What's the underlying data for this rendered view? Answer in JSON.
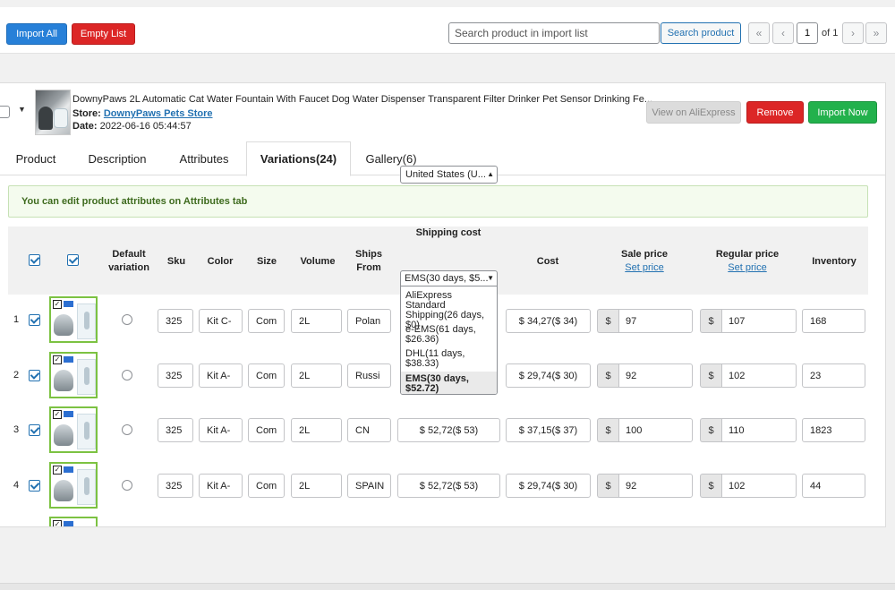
{
  "toolbar": {
    "import_all": "Import All",
    "empty_list": "Empty List",
    "search_placeholder": "Search product in import list",
    "search_button": "Search product",
    "first": "«",
    "prev": "‹",
    "page": "1",
    "of": "of 1",
    "next": "›",
    "last": "»"
  },
  "product": {
    "title": "DownyPaws 2L Automatic Cat Water Fountain With Faucet Dog Water Dispenser Transparent Filter Drinker Pet Sensor Drinking Fe...",
    "store_label": "Store:",
    "store_name": "DownyPaws Pets Store",
    "date_label": "Date:",
    "date": "2022-06-16 05:44:57",
    "view_btn": "View on AliExpress",
    "remove_btn": "Remove",
    "import_btn": "Import Now"
  },
  "tabs": [
    "Product",
    "Description",
    "Attributes",
    "Variations(24)",
    "Gallery(6)"
  ],
  "active_tab": "Variations(24)",
  "notice": "You can edit product attributes on Attributes tab",
  "table": {
    "headers": {
      "default_variation": "Default variation",
      "sku": "Sku",
      "color": "Color",
      "size": "Size",
      "volume": "Volume",
      "ships_from": "Ships From",
      "shipping_cost": "Shipping cost",
      "shipping_select": "United States (U...",
      "cost": "Cost",
      "sale_price": "Sale price",
      "regular_price": "Regular price",
      "set_price": "Set price",
      "inventory": "Inventory"
    },
    "currency": "$",
    "rows": [
      {
        "num": "1",
        "sku": "325",
        "color": "Kit C-",
        "size": "Com",
        "volume": "2L",
        "ships": "Polan",
        "ship_cost": "",
        "cost": "$ 34,27($ 34)",
        "sale": "97",
        "regular": "107",
        "inventory": "168"
      },
      {
        "num": "2",
        "sku": "325",
        "color": "Kit A-",
        "size": "Com",
        "volume": "2L",
        "ships": "Russi",
        "ship_cost": "",
        "cost": "$ 29,74($ 30)",
        "sale": "92",
        "regular": "102",
        "inventory": "23"
      },
      {
        "num": "3",
        "sku": "325",
        "color": "Kit A-",
        "size": "Com",
        "volume": "2L",
        "ships": "CN",
        "ship_cost": "$ 52,72($ 53)",
        "cost": "$ 37,15($ 37)",
        "sale": "100",
        "regular": "110",
        "inventory": "1823"
      },
      {
        "num": "4",
        "sku": "325",
        "color": "Kit A-",
        "size": "Com",
        "volume": "2L",
        "ships": "SPAIN",
        "ship_cost": "$ 52,72($ 53)",
        "cost": "$ 29,74($ 30)",
        "sale": "92",
        "regular": "102",
        "inventory": "44"
      }
    ]
  },
  "dropdown": {
    "selected": "EMS(30 days, $5...",
    "options": [
      "AliExpress Standard Shipping(26 days, $0)",
      "e-EMS(61 days, $26.36)",
      "DHL(11 days, $38.33)",
      "EMS(30 days, $52.72)"
    ]
  },
  "colors": {
    "blue": "#2780d8",
    "red": "#dc2626",
    "green": "#22b14c",
    "link": "#2271b1"
  }
}
